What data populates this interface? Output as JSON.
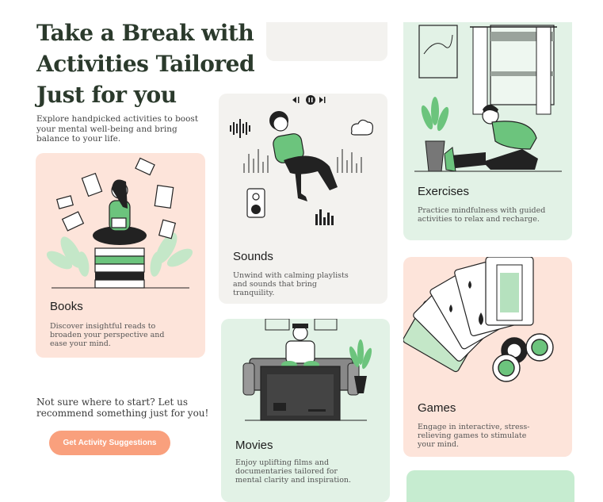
{
  "hero": {
    "title": "Take a Break with Activities Tailored Just for you",
    "subtitle": "Explore handpicked activities to boost your mental well-being and bring balance to your life."
  },
  "cards": {
    "books": {
      "title": "Books",
      "desc": "Discover insightful reads to broaden your perspective and ease your mind."
    },
    "sounds": {
      "title": "Sounds",
      "desc": "Unwind with calming playlists and sounds that bring tranquility."
    },
    "exercises": {
      "title": "Exercises",
      "desc": "Practice mindfulness with guided activities to relax and recharge."
    },
    "movies": {
      "title": "Movies",
      "desc": "Enjoy uplifting films and documentaries tailored for mental clarity and inspiration."
    },
    "games": {
      "title": "Games",
      "desc": "Engage in interactive, stress-relieving games to stimulate your mind."
    }
  },
  "recommend": {
    "prompt": "Not sure where to start? Let us recommend something just for you!",
    "button_label": "Get Activity Suggestions"
  },
  "colors": {
    "peach": "#fde4da",
    "green": "#e2f2e6",
    "gray": "#f3f2ef",
    "accent": "#f9a07d",
    "illustration_green": "#6cc47d"
  }
}
